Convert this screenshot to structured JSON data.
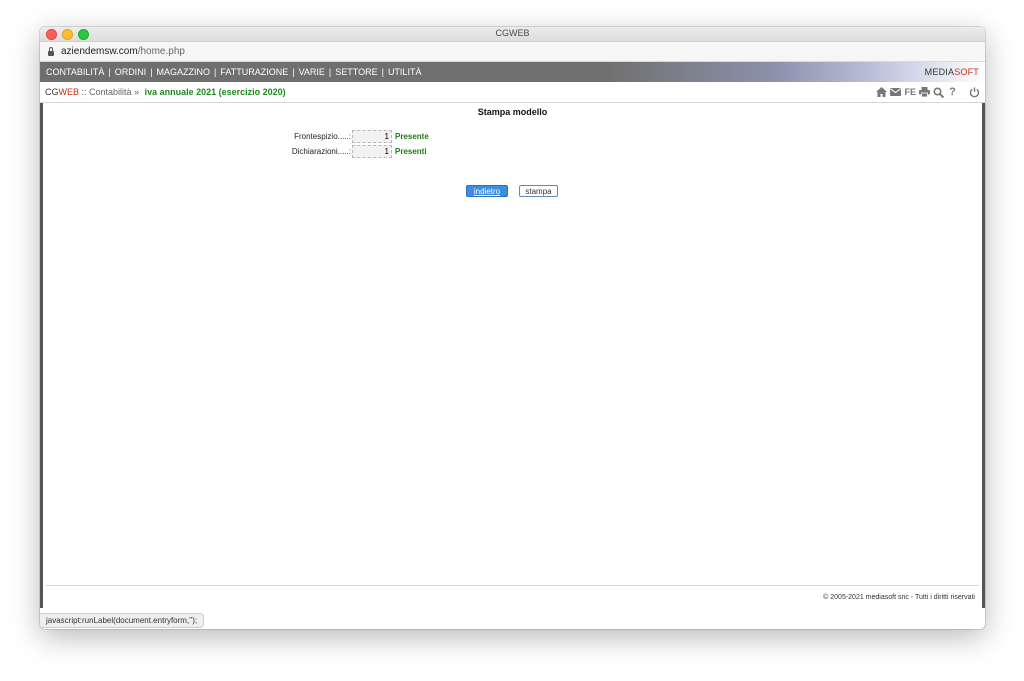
{
  "window": {
    "title": "CGWEB"
  },
  "address": {
    "domain": "aziendemsw.com",
    "path": "/home.php"
  },
  "nav": {
    "items": [
      "CONTABILITÀ",
      "ORDINI",
      "MAGAZZINO",
      "FATTURAZIONE",
      "VARIE",
      "SETTORE",
      "UTILITÀ"
    ],
    "separator": "|",
    "brand_part1": "MEDIA",
    "brand_part2": "SOFT"
  },
  "breadcrumb": {
    "app_part1": "CG",
    "app_part2": "WEB",
    "sep1": " :: ",
    "section": "Contabilità",
    "sep2": " » ",
    "current": "iva annuale 2021 (esercizio 2020)"
  },
  "toolbar": {
    "icons": [
      "home-icon",
      "mail-icon",
      "fe-icon",
      "print-icon",
      "search-icon",
      "help-icon",
      "power-icon"
    ],
    "fe_label": "FE",
    "help_label": "?"
  },
  "main": {
    "title": "Stampa modello",
    "rows": [
      {
        "label": "Frontespizio.....:",
        "value": "1",
        "status": "Presente"
      },
      {
        "label": "Dichiarazioni.....:",
        "value": "1",
        "status": "Presenti"
      }
    ],
    "back_label": "indietro",
    "print_label": "stampa"
  },
  "footer": {
    "copyright": "© 2005-2021 mediasoft snc - Tutti i diritti riservati"
  },
  "statusbar": {
    "text": "javascript:runLabel(document.entryform,'');"
  },
  "colors": {
    "accent_green": "#1e8a1e",
    "brand_red": "#d12a1c",
    "button_blue": "#3d8de0"
  }
}
